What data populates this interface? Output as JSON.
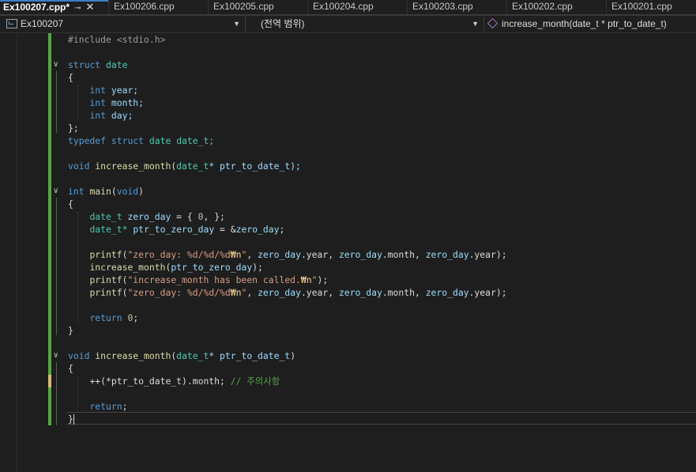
{
  "tabs": [
    {
      "label": "Ex100207.cpp*",
      "active": true,
      "pin_icon": "pin-icon",
      "close_icon": "close-icon"
    },
    {
      "label": "Ex100206.cpp"
    },
    {
      "label": "Ex100205.cpp"
    },
    {
      "label": "Ex100204.cpp"
    },
    {
      "label": "Ex100203.cpp"
    },
    {
      "label": "Ex100202.cpp"
    },
    {
      "label": "Ex100201.cpp"
    }
  ],
  "navbar": {
    "project": "Ex100207",
    "scope": "(전역 범위)",
    "member": "increase_month(date_t * ptr_to_date_t)"
  },
  "code": {
    "include": "#include <stdio.h>",
    "struct_kw": "struct",
    "struct_name": "date",
    "brace_open": "{",
    "brace_close": "}",
    "brace_close_semi": "};",
    "int_kw": "int",
    "field_year": "year;",
    "field_month": "month;",
    "field_day": "day;",
    "typedef_kw": "typedef",
    "struct_kw2": "struct",
    "date_word": "date",
    "date_t_semi": "date_t;",
    "void_kw": "void",
    "fn_increase": "increase_month",
    "lparen": "(",
    "date_t": "date_t",
    "ptr_param_decl": "* ptr_to_date_t);",
    "main_name": "main",
    "main_void": "void",
    "rparen": ")",
    "zero_day_decl_var": "zero_day",
    "zero_day_init_a": " = { ",
    "zero_num": "0",
    "zero_day_init_b": ", };",
    "date_t_star": "date_t*",
    "ptr_zero_var": "ptr_to_zero_day",
    "amp_eq": " = &",
    "zero_day_var": "zero_day",
    "semi": ";",
    "printf": "printf",
    "str1_a": "\"zero_day: %d/%d/%d",
    "escape": "₩n",
    "str_close": "\"",
    "comma": ", ",
    "dot_year": ".year",
    "dot_month": ".month",
    "end_paren": ");",
    "str2_a": "\"increase_month has been called.",
    "return_kw": "return",
    "return_val": "0",
    "ptr_param": "* ptr_to_date_t",
    "incr_a": "++(*ptr_to_date_t).month; ",
    "comment": "// 주의사항",
    "return_semi": ";"
  }
}
